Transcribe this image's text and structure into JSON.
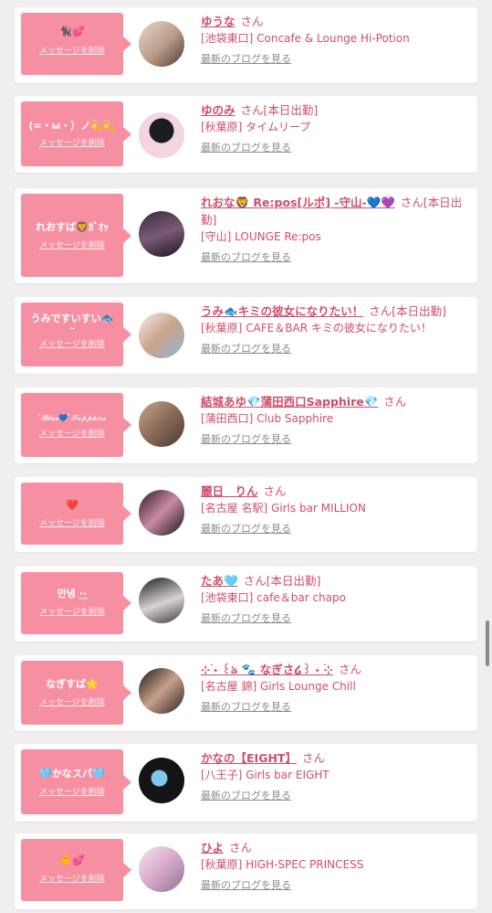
{
  "labels": {
    "delete": "メッセージを削除",
    "san": "さん",
    "blog": "最新のブログを見る"
  },
  "entries": [
    {
      "message": "🐈‍⬛💕",
      "name": "ゆうな",
      "suffix": "",
      "shop": "[池袋東口] Concafe & Lounge Hi-Potion"
    },
    {
      "message": "(=・ω・）ノ💫💫",
      "name": "ゆのみ",
      "suffix": "[本日出勤]",
      "shop": "[秋葉原] タイムリープ"
    },
    {
      "message": "れおすば🦁ｶﾞｵｯ",
      "name": "れおな🦁 Re:pos[ルポ] -守山-💙💜",
      "suffix": "[本日出勤]",
      "shop": "[守山] LOUNGE Re:pos"
    },
    {
      "message": "うみですいすい🐟",
      "message2": "~",
      "name": "うみ🐟キミの彼女になりたい！",
      "suffix": "[本日出勤]",
      "shop": "[秋葉原] CAFE＆BAR キミの彼女になりたい！"
    },
    {
      "message": "ﾟ𝓑𝓵𝓾𝓮💙ﾟ𝓢𝓪𝓹𝓹𝓱𝓲𝓻𝓮",
      "name": "結城あゆ💎蒲田西口Sapphire💎",
      "suffix": "",
      "shop": "[蒲田西口] Club Sapphire"
    },
    {
      "message": "❤️",
      "name": "麗日　りん",
      "suffix": "",
      "shop": "[名古屋 名駅] Girls bar MILLION"
    },
    {
      "message": "안녕 ·͜·",
      "name": "たあ🩵",
      "suffix": "[本日出勤]",
      "shop": "[池袋東口] cafe＆bar chapo"
    },
    {
      "message": "なぎすば🌟",
      "name": "⊹ ࣪˖ ꒰ঌ 🐾 なぎさ໒꒱ ˖ ࣪⊹",
      "suffix": "",
      "shop": "[名古屋 錦] Girls Lounge Chill"
    },
    {
      "message": "🩵かなスパ🩵",
      "name": "かなの【EIGHT】",
      "suffix": "",
      "shop": "[八王子] Girls bar EIGHT"
    },
    {
      "message": "🐥💕",
      "name": "ひよ",
      "suffix": "",
      "shop": "[秋葉原] HIGH-SPEC PRINCESS"
    }
  ]
}
